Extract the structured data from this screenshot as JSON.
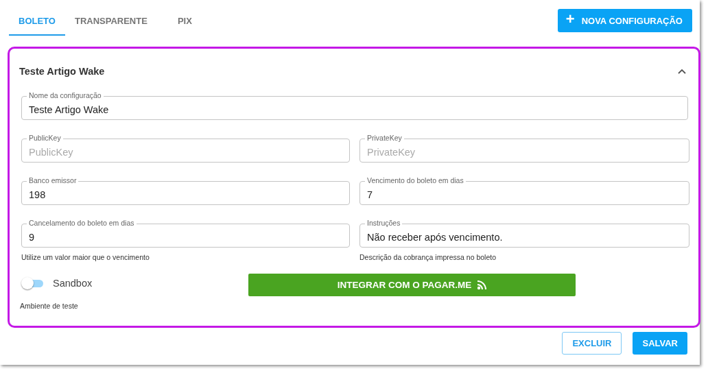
{
  "tabs": [
    {
      "label": "BOLETO",
      "selected": true
    },
    {
      "label": "TRANSPARENTE",
      "selected": false
    },
    {
      "label": "PIX",
      "selected": false
    }
  ],
  "new_button": {
    "icon": "+",
    "label": "NOVA CONFIGURAÇÃO"
  },
  "panel": {
    "title": "Teste Artigo Wake",
    "expanded": true,
    "name_field": {
      "label": "Nome da configuração",
      "value": "Teste Artigo Wake"
    },
    "rows": [
      [
        {
          "label": "PublicKey",
          "placeholder": "PublicKey"
        },
        {
          "label": "PrivateKey",
          "placeholder": "PrivateKey"
        }
      ],
      [
        {
          "label": "Banco emissor",
          "value": "198"
        },
        {
          "label": "Vencimento do boleto em dias",
          "value": "7"
        }
      ],
      [
        {
          "label": "Cancelamento do boleto em dias",
          "value": "9",
          "helper": "Utilize um valor maior que o vencimento"
        },
        {
          "label": "Instruções",
          "value": "Não receber após vencimento.",
          "helper": "Descrição da cobrança impressa no boleto"
        }
      ]
    ],
    "sandbox": {
      "label": "Sandbox",
      "on": false,
      "helper": "Ambiente de teste"
    },
    "integrate_button": "INTEGRAR COM O PAGAR.ME"
  },
  "actions": [
    "EXCLUIR",
    "SALVAR"
  ]
}
